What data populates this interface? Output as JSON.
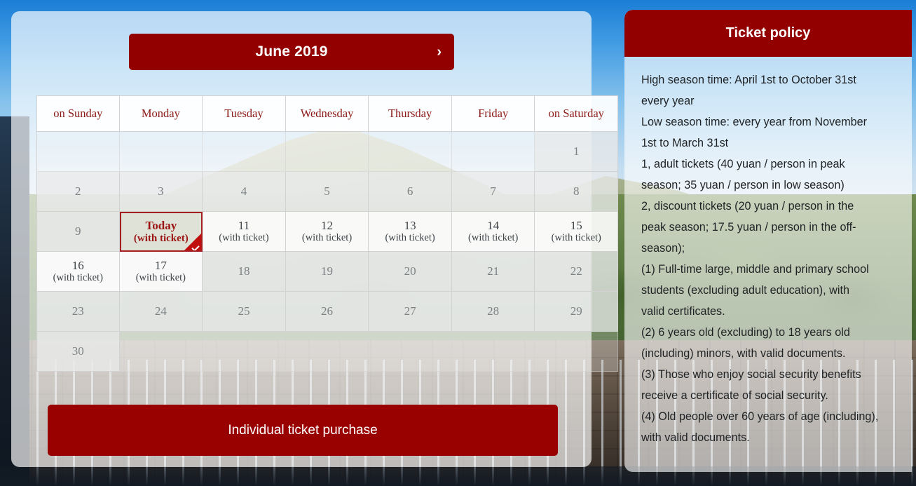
{
  "background": {
    "description": "great-wall-of-china-photo",
    "sky_color": "#3f9ae2",
    "wall_color": "#4b4036"
  },
  "theme": {
    "primary_red": "#930000",
    "button_red": "#990000",
    "today_border": "#a42020",
    "today_text": "#9c1414",
    "weekday_text": "#8b1a16",
    "badge_red": "#c00d0d"
  },
  "calendar": {
    "month_label": "June 2019",
    "next_month_icon": "chevron-right-icon",
    "weekdays": [
      "on Sunday",
      "Monday",
      "Tuesday",
      "Wednesday",
      "Thursday",
      "Friday",
      "on Saturday"
    ],
    "ticket_note": "(with ticket)",
    "today_label": "Today",
    "weeks": [
      [
        {
          "day": "",
          "state": "empty",
          "ticket": ""
        },
        {
          "day": "",
          "state": "empty",
          "ticket": ""
        },
        {
          "day": "",
          "state": "empty",
          "ticket": ""
        },
        {
          "day": "",
          "state": "empty",
          "ticket": ""
        },
        {
          "day": "",
          "state": "empty",
          "ticket": ""
        },
        {
          "day": "",
          "state": "empty",
          "ticket": ""
        },
        {
          "day": "1",
          "state": "unavailable",
          "ticket": ""
        }
      ],
      [
        {
          "day": "2",
          "state": "unavailable",
          "ticket": ""
        },
        {
          "day": "3",
          "state": "unavailable",
          "ticket": ""
        },
        {
          "day": "4",
          "state": "unavailable",
          "ticket": ""
        },
        {
          "day": "5",
          "state": "unavailable",
          "ticket": ""
        },
        {
          "day": "6",
          "state": "unavailable",
          "ticket": ""
        },
        {
          "day": "7",
          "state": "unavailable",
          "ticket": ""
        },
        {
          "day": "8",
          "state": "unavailable",
          "ticket": ""
        }
      ],
      [
        {
          "day": "9",
          "state": "unavailable",
          "ticket": ""
        },
        {
          "day": "Today",
          "state": "today",
          "ticket": "(with ticket)"
        },
        {
          "day": "11",
          "state": "available",
          "ticket": "(with ticket)"
        },
        {
          "day": "12",
          "state": "available",
          "ticket": "(with ticket)"
        },
        {
          "day": "13",
          "state": "available",
          "ticket": "(with ticket)"
        },
        {
          "day": "14",
          "state": "available",
          "ticket": "(with ticket)"
        },
        {
          "day": "15",
          "state": "available",
          "ticket": "(with ticket)"
        }
      ],
      [
        {
          "day": "16",
          "state": "available",
          "ticket": "(with ticket)"
        },
        {
          "day": "17",
          "state": "available",
          "ticket": "(with ticket)"
        },
        {
          "day": "18",
          "state": "unavailable",
          "ticket": ""
        },
        {
          "day": "19",
          "state": "unavailable",
          "ticket": ""
        },
        {
          "day": "20",
          "state": "unavailable",
          "ticket": ""
        },
        {
          "day": "21",
          "state": "unavailable",
          "ticket": ""
        },
        {
          "day": "22",
          "state": "unavailable",
          "ticket": ""
        }
      ],
      [
        {
          "day": "23",
          "state": "unavailable",
          "ticket": ""
        },
        {
          "day": "24",
          "state": "unavailable",
          "ticket": ""
        },
        {
          "day": "25",
          "state": "unavailable",
          "ticket": ""
        },
        {
          "day": "26",
          "state": "unavailable",
          "ticket": ""
        },
        {
          "day": "27",
          "state": "unavailable",
          "ticket": ""
        },
        {
          "day": "28",
          "state": "unavailable",
          "ticket": ""
        },
        {
          "day": "29",
          "state": "unavailable",
          "ticket": ""
        }
      ],
      [
        {
          "day": "30",
          "state": "unavailable",
          "ticket": ""
        },
        {
          "day": "",
          "state": "empty",
          "ticket": ""
        },
        {
          "day": "",
          "state": "empty",
          "ticket": ""
        },
        {
          "day": "",
          "state": "empty",
          "ticket": ""
        },
        {
          "day": "",
          "state": "empty",
          "ticket": ""
        },
        {
          "day": "",
          "state": "empty",
          "ticket": ""
        },
        {
          "day": "",
          "state": "empty",
          "ticket": ""
        }
      ]
    ]
  },
  "purchase": {
    "label": "Individual ticket purchase"
  },
  "policy": {
    "title": "Ticket policy",
    "lines": [
      "High season time: April 1st to October 31st",
      "every year",
      "Low season time: every year from November",
      "1st to March 31st",
      "1, adult tickets (40 yuan / person in peak",
      "season; 35 yuan / person in low season)",
      "2, discount tickets (20 yuan / person in the",
      "peak season; 17.5 yuan / person in the off-",
      "season);",
      "(1) Full-time large, middle and primary school",
      "students (excluding adult education), with",
      "valid certificates.",
      "(2) 6 years old (excluding) to 18 years old",
      "(including) minors, with valid documents.",
      "(3) Those who enjoy social security benefits",
      "receive a certificate of social security.",
      "(4) Old people over 60 years of age (including),",
      "with valid documents."
    ]
  }
}
